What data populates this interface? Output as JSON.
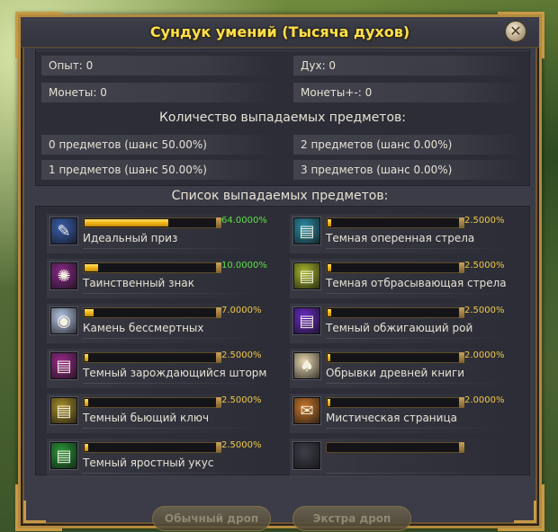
{
  "window": {
    "title": "Сундук умений (Тысяча духов)",
    "close_glyph": "✕"
  },
  "stats": {
    "exp": "Опыт: 0",
    "spirit": "Дух: 0",
    "coins": "Монеты: 0",
    "coins_bound": "Монеты+-: 0"
  },
  "drop_count": {
    "heading": "Количество выпадаемых предметов:",
    "options": [
      "0 предметов (шанс 50.00%)",
      "2 предметов (шанс 0.00%)",
      "1 предметов (шанс 50.00%)",
      "3 предметов (шанс 0.00%)"
    ]
  },
  "drop_list": {
    "heading": "Список выпадаемых предметов:",
    "items": [
      {
        "name": "Идеальный приз",
        "percent": "64.0000%",
        "fraction": 0.64,
        "icon": "scroll-icon",
        "color": "#3a5fb0",
        "highlight": true
      },
      {
        "name": "Темная оперенная стрела",
        "percent": "2.5000%",
        "fraction": 0.025,
        "icon": "book-teal-icon",
        "color": "#2a8fa8",
        "highlight": false
      },
      {
        "name": "Таинственный знак",
        "percent": "10.0000%",
        "fraction": 0.1,
        "icon": "rune-icon",
        "color": "#8a2a8a",
        "highlight": true
      },
      {
        "name": "Темная отбрасывающая стрела",
        "percent": "2.5000%",
        "fraction": 0.025,
        "icon": "book-yellowgreen-icon",
        "color": "#a8b82a",
        "highlight": false
      },
      {
        "name": "Камень бессмертных",
        "percent": "7.0000%",
        "fraction": 0.07,
        "icon": "crystal-icon",
        "color": "#b8c8e8",
        "highlight": false
      },
      {
        "name": "Темный обжигающий рой",
        "percent": "2.5000%",
        "fraction": 0.025,
        "icon": "book-purple-icon",
        "color": "#6a2ac8",
        "highlight": false
      },
      {
        "name": "Темный зарождающийся шторм",
        "percent": "2.5000%",
        "fraction": 0.025,
        "icon": "book-magenta-icon",
        "color": "#9a2a8a",
        "highlight": false
      },
      {
        "name": "Обрывки древней книги",
        "percent": "2.0000%",
        "fraction": 0.02,
        "icon": "card-icon",
        "color": "#e8d8b0",
        "highlight": false
      },
      {
        "name": "Темный бьющий ключ",
        "percent": "2.5000%",
        "fraction": 0.025,
        "icon": "book-gold-icon",
        "color": "#a8902a",
        "highlight": false
      },
      {
        "name": "Мистическая страница",
        "percent": "2.0000%",
        "fraction": 0.02,
        "icon": "parchment-icon",
        "color": "#c8782a",
        "highlight": false
      },
      {
        "name": "Темный яростный укус",
        "percent": "2.5000%",
        "fraction": 0.025,
        "icon": "book-green-icon",
        "color": "#2a9a3a",
        "highlight": false
      },
      {
        "name": "",
        "percent": "",
        "fraction": 0,
        "icon": "empty-slot-icon",
        "color": "#3e3f4a",
        "highlight": false
      }
    ]
  },
  "buttons": {
    "normal_drop": "Обычный дроп",
    "extra_drop": "Экстра дроп"
  }
}
